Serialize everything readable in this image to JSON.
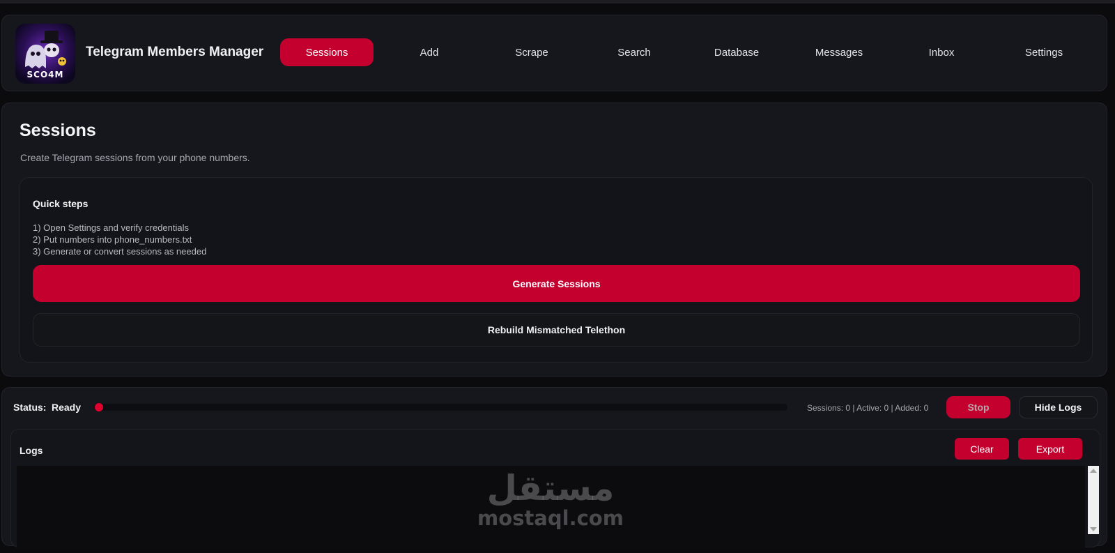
{
  "header": {
    "title": "Telegram Members Manager",
    "logo_text": "SCO4M"
  },
  "nav": {
    "items": [
      {
        "label": "Sessions",
        "active": true
      },
      {
        "label": "Add",
        "active": false
      },
      {
        "label": "Scrape",
        "active": false
      },
      {
        "label": "Search",
        "active": false
      },
      {
        "label": "Database",
        "active": false
      },
      {
        "label": "Messages",
        "active": false
      },
      {
        "label": "Inbox",
        "active": false
      },
      {
        "label": "Settings",
        "active": false
      }
    ]
  },
  "sessions": {
    "title": "Sessions",
    "subtitle": "Create Telegram sessions from your phone numbers.",
    "quick_steps_title": "Quick steps",
    "steps": [
      "1) Open Settings and verify credentials",
      "2) Put numbers into phone_numbers.txt",
      "3) Generate or convert sessions as needed"
    ],
    "generate_label": "Generate Sessions",
    "rebuild_label": "Rebuild Mismatched Telethon"
  },
  "status": {
    "label": "Status:",
    "value": "Ready",
    "progress": 0,
    "counters": "Sessions: 0 | Active: 0 | Added: 0",
    "stop_label": "Stop",
    "hide_logs_label": "Hide Logs"
  },
  "logs": {
    "title": "Logs",
    "clear_label": "Clear",
    "export_label": "Export"
  },
  "watermark": {
    "arabic": "مستقل",
    "latin": "mostaql.com"
  },
  "colors": {
    "accent": "#c4002f",
    "background": "#0b0b0e",
    "panel": "#16171c"
  }
}
